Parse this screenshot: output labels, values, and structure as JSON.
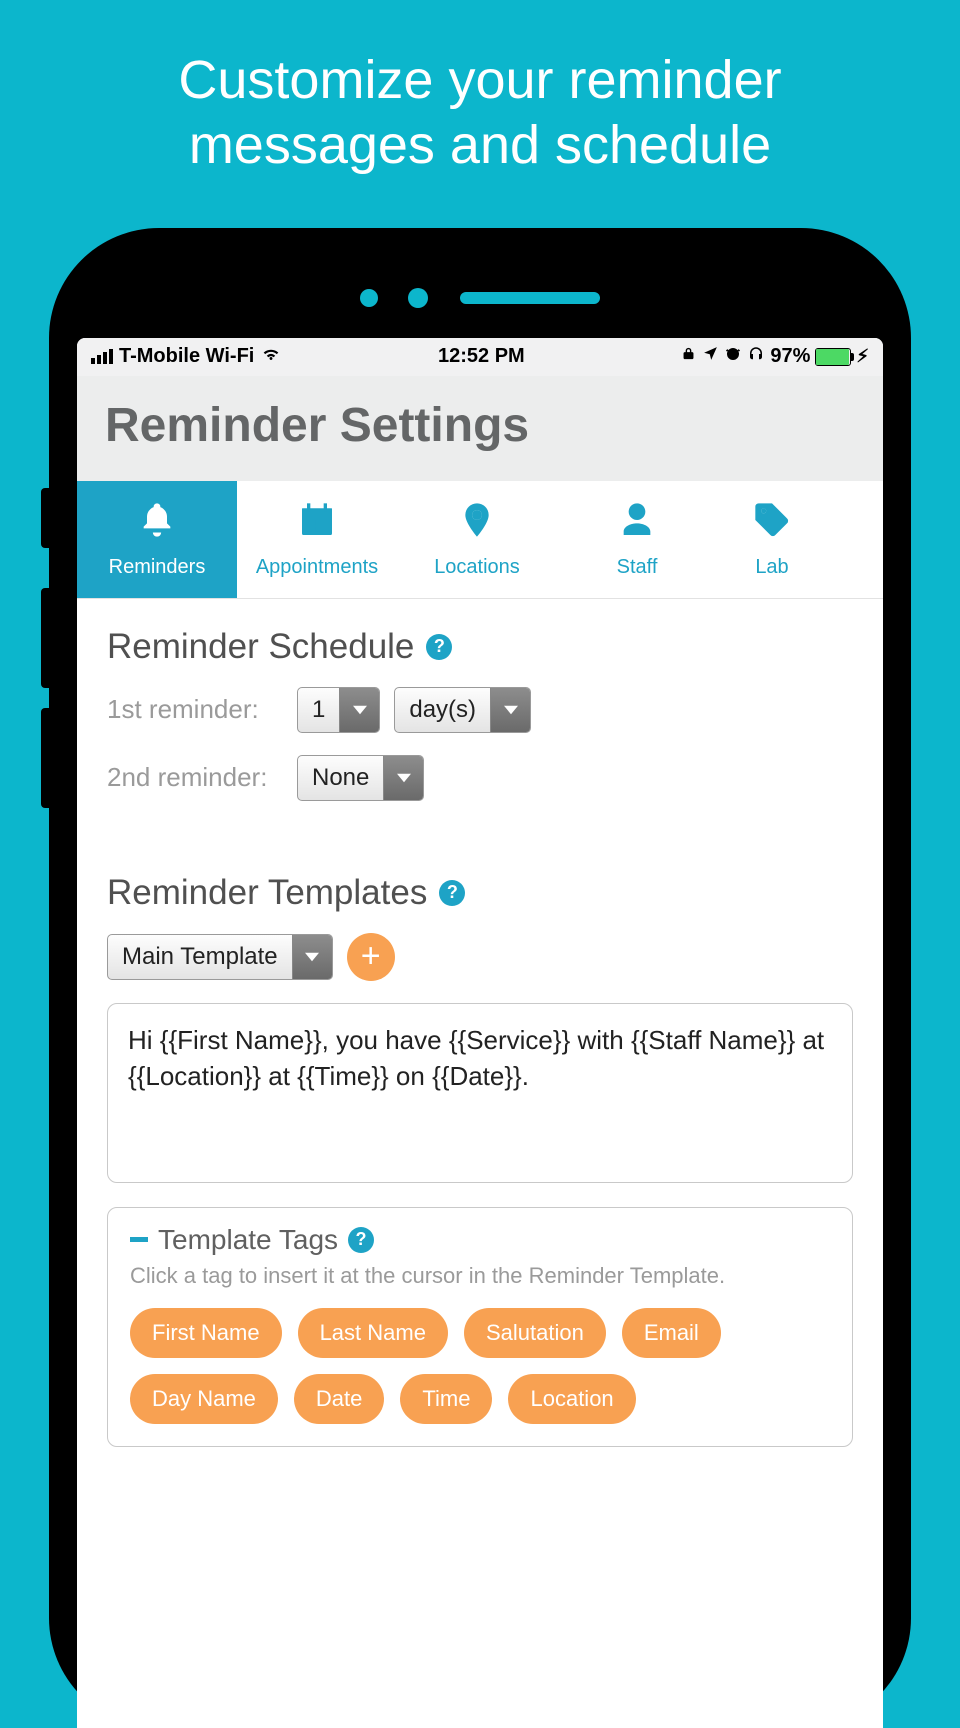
{
  "promo": "Customize your reminder messages and schedule",
  "status": {
    "carrier": "T-Mobile Wi-Fi",
    "time": "12:52 PM",
    "battery_pct": "97%"
  },
  "header": {
    "title": "Reminder Settings"
  },
  "tabs": [
    {
      "label": "Reminders"
    },
    {
      "label": "Appointments"
    },
    {
      "label": "Locations"
    },
    {
      "label": "Staff"
    },
    {
      "label": "Lab"
    }
  ],
  "schedule": {
    "title": "Reminder Schedule",
    "row1_label": "1st reminder:",
    "row1_value": "1",
    "row1_unit": "day(s)",
    "row2_label": "2nd reminder:",
    "row2_value": "None"
  },
  "templates": {
    "title": "Reminder Templates",
    "select_value": "Main Template",
    "textarea": "Hi {{First Name}}, you have {{Service}} with {{Staff Name}} at {{Location}} at {{Time}} on {{Date}}."
  },
  "tags": {
    "title": "Template Tags",
    "help": "Click a tag to insert it at the cursor in the Reminder Template.",
    "items": [
      "First Name",
      "Last Name",
      "Salutation",
      "Email",
      "Day Name",
      "Date",
      "Time",
      "Location"
    ]
  }
}
